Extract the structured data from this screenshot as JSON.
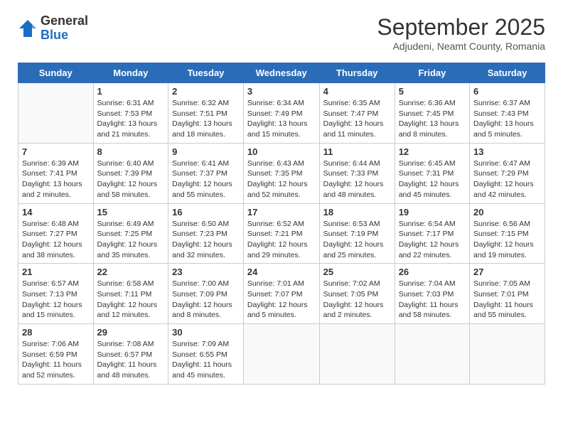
{
  "header": {
    "logo_general": "General",
    "logo_blue": "Blue",
    "month_title": "September 2025",
    "subtitle": "Adjudeni, Neamt County, Romania"
  },
  "days_of_week": [
    "Sunday",
    "Monday",
    "Tuesday",
    "Wednesday",
    "Thursday",
    "Friday",
    "Saturday"
  ],
  "weeks": [
    [
      {
        "num": "",
        "info": ""
      },
      {
        "num": "1",
        "info": "Sunrise: 6:31 AM\nSunset: 7:53 PM\nDaylight: 13 hours\nand 21 minutes."
      },
      {
        "num": "2",
        "info": "Sunrise: 6:32 AM\nSunset: 7:51 PM\nDaylight: 13 hours\nand 18 minutes."
      },
      {
        "num": "3",
        "info": "Sunrise: 6:34 AM\nSunset: 7:49 PM\nDaylight: 13 hours\nand 15 minutes."
      },
      {
        "num": "4",
        "info": "Sunrise: 6:35 AM\nSunset: 7:47 PM\nDaylight: 13 hours\nand 11 minutes."
      },
      {
        "num": "5",
        "info": "Sunrise: 6:36 AM\nSunset: 7:45 PM\nDaylight: 13 hours\nand 8 minutes."
      },
      {
        "num": "6",
        "info": "Sunrise: 6:37 AM\nSunset: 7:43 PM\nDaylight: 13 hours\nand 5 minutes."
      }
    ],
    [
      {
        "num": "7",
        "info": "Sunrise: 6:39 AM\nSunset: 7:41 PM\nDaylight: 13 hours\nand 2 minutes."
      },
      {
        "num": "8",
        "info": "Sunrise: 6:40 AM\nSunset: 7:39 PM\nDaylight: 12 hours\nand 58 minutes."
      },
      {
        "num": "9",
        "info": "Sunrise: 6:41 AM\nSunset: 7:37 PM\nDaylight: 12 hours\nand 55 minutes."
      },
      {
        "num": "10",
        "info": "Sunrise: 6:43 AM\nSunset: 7:35 PM\nDaylight: 12 hours\nand 52 minutes."
      },
      {
        "num": "11",
        "info": "Sunrise: 6:44 AM\nSunset: 7:33 PM\nDaylight: 12 hours\nand 48 minutes."
      },
      {
        "num": "12",
        "info": "Sunrise: 6:45 AM\nSunset: 7:31 PM\nDaylight: 12 hours\nand 45 minutes."
      },
      {
        "num": "13",
        "info": "Sunrise: 6:47 AM\nSunset: 7:29 PM\nDaylight: 12 hours\nand 42 minutes."
      }
    ],
    [
      {
        "num": "14",
        "info": "Sunrise: 6:48 AM\nSunset: 7:27 PM\nDaylight: 12 hours\nand 38 minutes."
      },
      {
        "num": "15",
        "info": "Sunrise: 6:49 AM\nSunset: 7:25 PM\nDaylight: 12 hours\nand 35 minutes."
      },
      {
        "num": "16",
        "info": "Sunrise: 6:50 AM\nSunset: 7:23 PM\nDaylight: 12 hours\nand 32 minutes."
      },
      {
        "num": "17",
        "info": "Sunrise: 6:52 AM\nSunset: 7:21 PM\nDaylight: 12 hours\nand 29 minutes."
      },
      {
        "num": "18",
        "info": "Sunrise: 6:53 AM\nSunset: 7:19 PM\nDaylight: 12 hours\nand 25 minutes."
      },
      {
        "num": "19",
        "info": "Sunrise: 6:54 AM\nSunset: 7:17 PM\nDaylight: 12 hours\nand 22 minutes."
      },
      {
        "num": "20",
        "info": "Sunrise: 6:56 AM\nSunset: 7:15 PM\nDaylight: 12 hours\nand 19 minutes."
      }
    ],
    [
      {
        "num": "21",
        "info": "Sunrise: 6:57 AM\nSunset: 7:13 PM\nDaylight: 12 hours\nand 15 minutes."
      },
      {
        "num": "22",
        "info": "Sunrise: 6:58 AM\nSunset: 7:11 PM\nDaylight: 12 hours\nand 12 minutes."
      },
      {
        "num": "23",
        "info": "Sunrise: 7:00 AM\nSunset: 7:09 PM\nDaylight: 12 hours\nand 8 minutes."
      },
      {
        "num": "24",
        "info": "Sunrise: 7:01 AM\nSunset: 7:07 PM\nDaylight: 12 hours\nand 5 minutes."
      },
      {
        "num": "25",
        "info": "Sunrise: 7:02 AM\nSunset: 7:05 PM\nDaylight: 12 hours\nand 2 minutes."
      },
      {
        "num": "26",
        "info": "Sunrise: 7:04 AM\nSunset: 7:03 PM\nDaylight: 11 hours\nand 58 minutes."
      },
      {
        "num": "27",
        "info": "Sunrise: 7:05 AM\nSunset: 7:01 PM\nDaylight: 11 hours\nand 55 minutes."
      }
    ],
    [
      {
        "num": "28",
        "info": "Sunrise: 7:06 AM\nSunset: 6:59 PM\nDaylight: 11 hours\nand 52 minutes."
      },
      {
        "num": "29",
        "info": "Sunrise: 7:08 AM\nSunset: 6:57 PM\nDaylight: 11 hours\nand 48 minutes."
      },
      {
        "num": "30",
        "info": "Sunrise: 7:09 AM\nSunset: 6:55 PM\nDaylight: 11 hours\nand 45 minutes."
      },
      {
        "num": "",
        "info": ""
      },
      {
        "num": "",
        "info": ""
      },
      {
        "num": "",
        "info": ""
      },
      {
        "num": "",
        "info": ""
      }
    ]
  ]
}
